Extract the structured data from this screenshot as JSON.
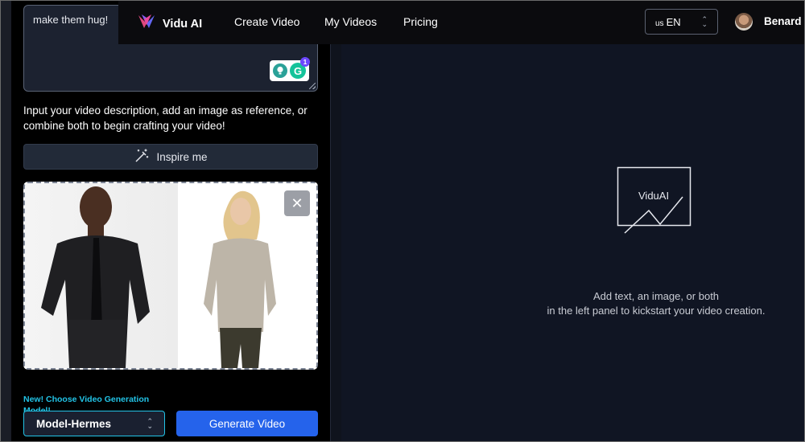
{
  "prompt": {
    "value": "make them hug!",
    "grammar_badge": "1"
  },
  "helper_text": "Input your video description, add an image as reference, or combine both to begin crafting your video!",
  "inspire_button": {
    "label": "Inspire me"
  },
  "image_upload": {
    "close_symbol": "✕"
  },
  "model": {
    "new_label": "New! Choose Video Generation Model!",
    "selected": "Model-Hermes"
  },
  "generate_button": {
    "label": "Generate Video"
  },
  "nav": {
    "brand": "Vidu AI",
    "items": [
      {
        "label": "Create Video"
      },
      {
        "label": "My Videos"
      },
      {
        "label": "Pricing"
      }
    ],
    "language": {
      "flag": "us",
      "code": "EN"
    },
    "user_name": "Benard I"
  },
  "preview": {
    "placeholder_label": "ViduAI",
    "empty_line1": "Add text, an image, or both",
    "empty_line2": "in the left panel to kickstart your video creation."
  },
  "colors": {
    "accent_blue": "#2563eb",
    "accent_cyan": "#22c3e6",
    "background": "#101523"
  }
}
